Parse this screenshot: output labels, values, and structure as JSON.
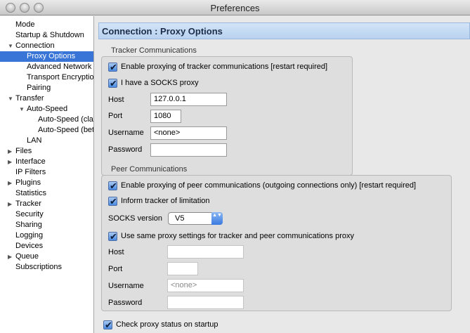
{
  "window": {
    "title": "Preferences"
  },
  "sidebar": {
    "items": [
      {
        "label": "Mode",
        "tri": ""
      },
      {
        "label": "Startup & Shutdown",
        "tri": ""
      },
      {
        "label": "Connection",
        "tri": "▼"
      },
      {
        "label": "Proxy Options",
        "tri": ""
      },
      {
        "label": "Advanced Network",
        "tri": ""
      },
      {
        "label": "Transport Encryption",
        "tri": ""
      },
      {
        "label": "Pairing",
        "tri": ""
      },
      {
        "label": "Transfer",
        "tri": "▼"
      },
      {
        "label": "Auto-Speed",
        "tri": "▼"
      },
      {
        "label": "Auto-Speed (classic)",
        "tri": ""
      },
      {
        "label": "Auto-Speed (beta)",
        "tri": ""
      },
      {
        "label": "LAN",
        "tri": ""
      },
      {
        "label": "Files",
        "tri": "▶"
      },
      {
        "label": "Interface",
        "tri": "▶"
      },
      {
        "label": "IP Filters",
        "tri": ""
      },
      {
        "label": "Plugins",
        "tri": "▶"
      },
      {
        "label": "Statistics",
        "tri": ""
      },
      {
        "label": "Tracker",
        "tri": "▶"
      },
      {
        "label": "Security",
        "tri": ""
      },
      {
        "label": "Sharing",
        "tri": ""
      },
      {
        "label": "Logging",
        "tri": ""
      },
      {
        "label": "Devices",
        "tri": ""
      },
      {
        "label": "Queue",
        "tri": "▶"
      },
      {
        "label": "Subscriptions",
        "tri": ""
      }
    ]
  },
  "main": {
    "header": "Connection : Proxy Options",
    "tracker": {
      "title": "Tracker Communications",
      "enable_label": "Enable proxying of tracker communications [restart required]",
      "socks_label": "I have a SOCKS proxy",
      "host_label": "Host",
      "host_value": "127.0.0.1",
      "port_label": "Port",
      "port_value": "1080",
      "username_label": "Username",
      "username_value": "<none>",
      "password_label": "Password",
      "password_value": ""
    },
    "peer": {
      "title": "Peer Communications",
      "enable_label": "Enable proxying of peer communications (outgoing connections only) [restart required]",
      "inform_label": "Inform tracker of limitation",
      "socks_version_label": "SOCKS version",
      "socks_version_value": "V5",
      "same_label": "Use same proxy settings for tracker and peer communications proxy",
      "host_label": "Host",
      "host_value": "",
      "port_label": "Port",
      "port_value": "",
      "username_label": "Username",
      "username_value": "<none>",
      "password_label": "Password",
      "password_value": ""
    },
    "check_status_label": "Check proxy status on startup"
  },
  "checkmark": "✔",
  "popup_arrows": "▲▼"
}
